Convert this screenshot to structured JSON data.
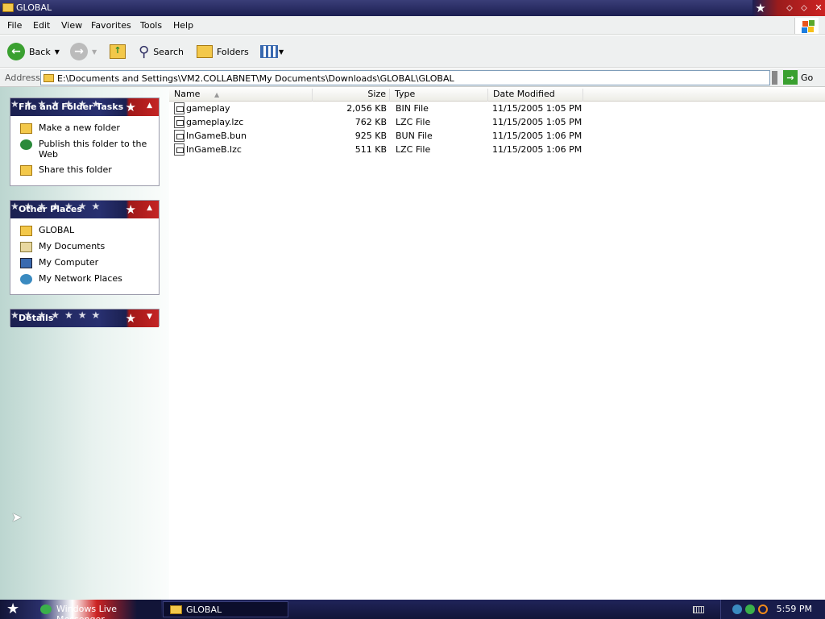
{
  "window": {
    "title": "GLOBAL"
  },
  "menu": [
    "File",
    "Edit",
    "View",
    "Favorites",
    "Tools",
    "Help"
  ],
  "toolbar": {
    "back_label": "Back",
    "search_label": "Search",
    "folders_label": "Folders"
  },
  "address": {
    "label": "Address",
    "path": "E:\\Documents and Settings\\VM2.COLLABNET\\My Documents\\Downloads\\GLOBAL\\GLOBAL",
    "go_label": "Go"
  },
  "tasks_panel": {
    "title": "File and Folder Tasks",
    "items": [
      "Make a new folder",
      "Publish this folder to the Web",
      "Share this folder"
    ]
  },
  "places_panel": {
    "title": "Other Places",
    "items": [
      "GLOBAL",
      "My Documents",
      "My Computer",
      "My Network Places"
    ]
  },
  "details_panel": {
    "title": "Details"
  },
  "columns": {
    "name": "Name",
    "size": "Size",
    "type": "Type",
    "date": "Date Modified"
  },
  "files": [
    {
      "name": "gameplay",
      "size": "2,056 KB",
      "type": "BIN File",
      "date": "11/15/2005 1:05 PM"
    },
    {
      "name": "gameplay.lzc",
      "size": "762 KB",
      "type": "LZC File",
      "date": "11/15/2005 1:05 PM"
    },
    {
      "name": "InGameB.bun",
      "size": "925 KB",
      "type": "BUN File",
      "date": "11/15/2005 1:06 PM"
    },
    {
      "name": "InGameB.lzc",
      "size": "511 KB",
      "type": "LZC File",
      "date": "11/15/2005 1:06 PM"
    }
  ],
  "taskbar": {
    "items": [
      "Windows Live Messenger",
      "GLOBAL"
    ],
    "clock": "5:59 PM"
  }
}
